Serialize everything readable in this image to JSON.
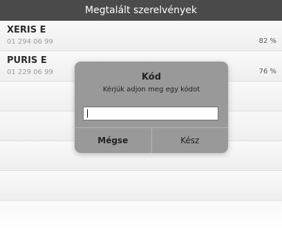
{
  "header": {
    "title": "Megtalált szerelvények"
  },
  "results": [
    {
      "name": "XERIS E",
      "code": "01 294 06 99",
      "match": "82 %"
    },
    {
      "name": "PURIS E",
      "code": "01 229 06 99",
      "match": "76 %"
    }
  ],
  "dialog": {
    "title": "Kód",
    "message": "Kérjük adjon meg egy kódot",
    "input_value": "",
    "cancel_label": "Mégse",
    "done_label": "Kész"
  }
}
